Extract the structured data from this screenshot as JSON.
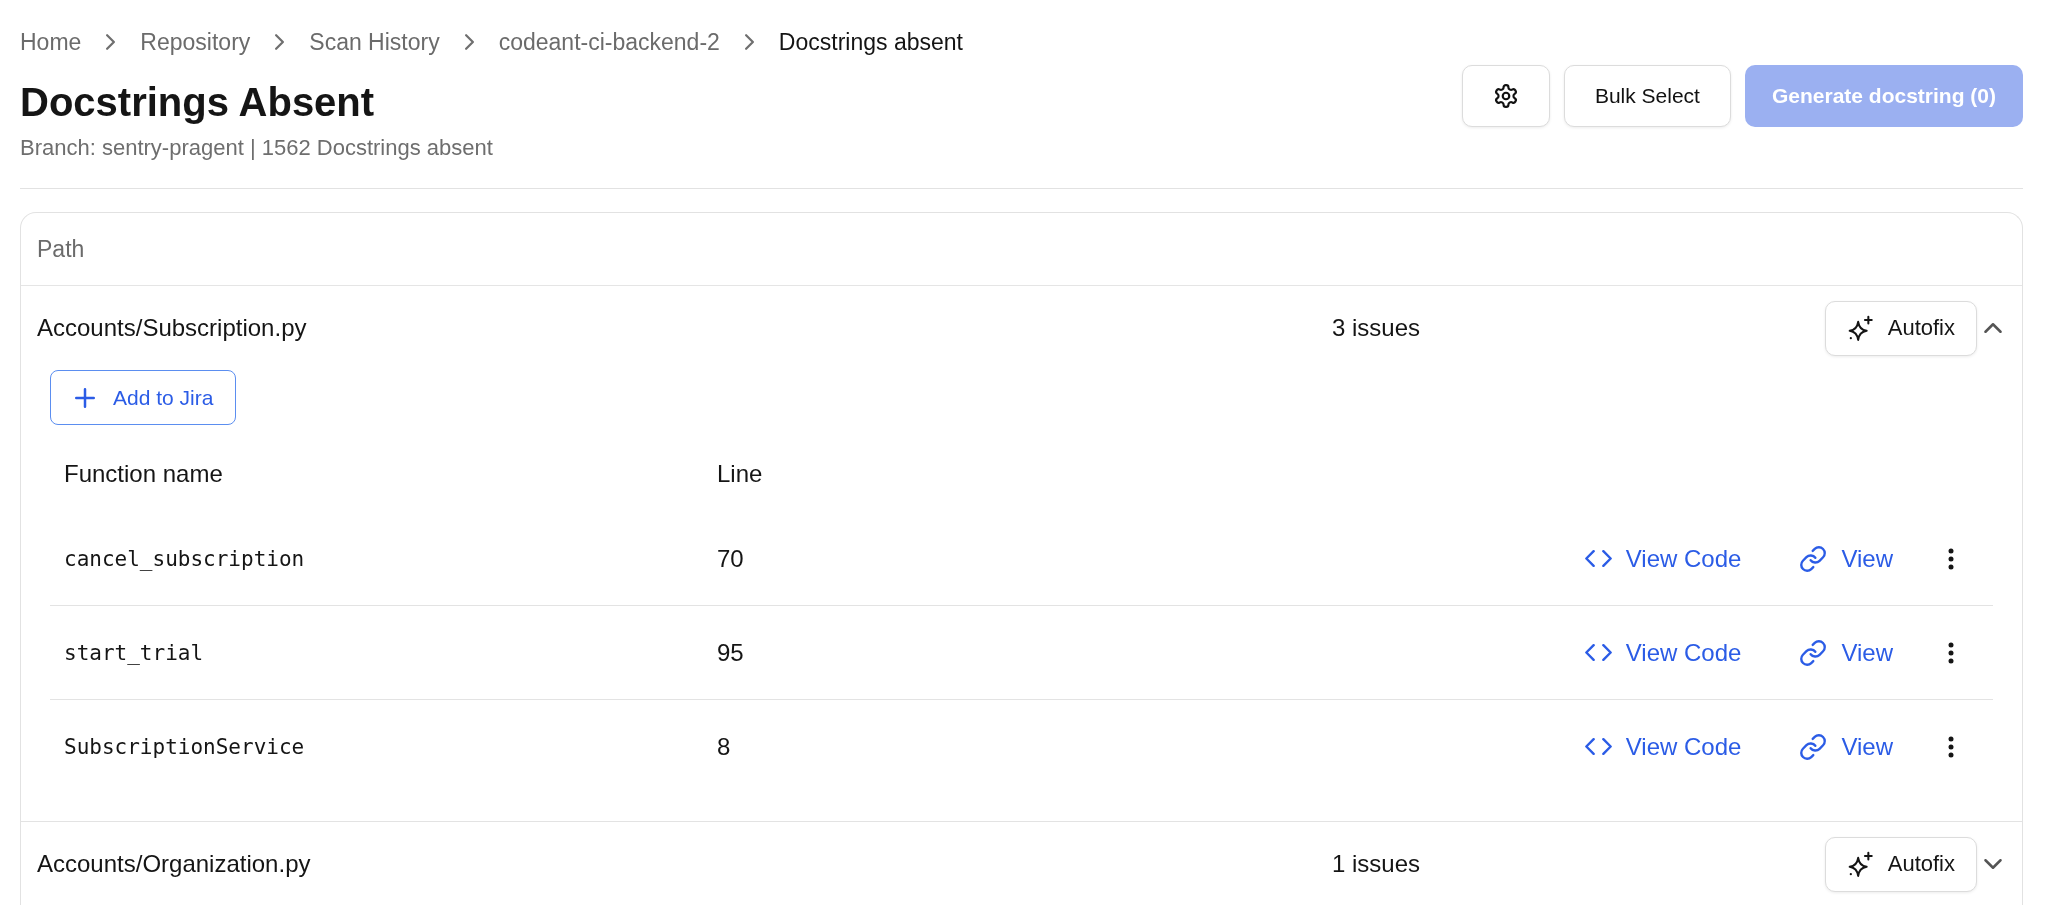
{
  "breadcrumb": [
    {
      "label": "Home",
      "current": false
    },
    {
      "label": "Repository",
      "current": false
    },
    {
      "label": "Scan History",
      "current": false
    },
    {
      "label": "codeant-ci-backend-2",
      "current": false
    },
    {
      "label": "Docstrings absent",
      "current": true
    }
  ],
  "header": {
    "title": "Docstrings Absent",
    "subtitle": "Branch: sentry-pragent | 1562 Docstrings absent"
  },
  "toolbar": {
    "buttons": [
      {
        "kind": "icon",
        "disabled": false
      },
      {
        "kind": "outline",
        "label": "Bulk Select",
        "disabled": false
      },
      {
        "kind": "primary",
        "label": "Generate docstring (0)",
        "disabled": true
      }
    ]
  },
  "table": {
    "header": "Path",
    "groups": [
      {
        "path": "Accounts/Subscription.py",
        "issues": "3 issues",
        "autofix": "Autofix",
        "expanded": true,
        "jira_button": "Add to Jira",
        "columns": [
          "Function name",
          "Line"
        ],
        "rows": [
          {
            "function": "cancel_subscription",
            "line": "70",
            "view_code": "View Code",
            "view": "View"
          },
          {
            "function": "start_trial",
            "line": "95",
            "view_code": "View Code",
            "view": "View"
          },
          {
            "function": "SubscriptionService",
            "line": "8",
            "view_code": "View Code",
            "view": "View"
          }
        ]
      },
      {
        "path": "Accounts/Organization.py",
        "issues": "1 issues",
        "autofix": "Autofix",
        "expanded": false
      }
    ]
  }
}
